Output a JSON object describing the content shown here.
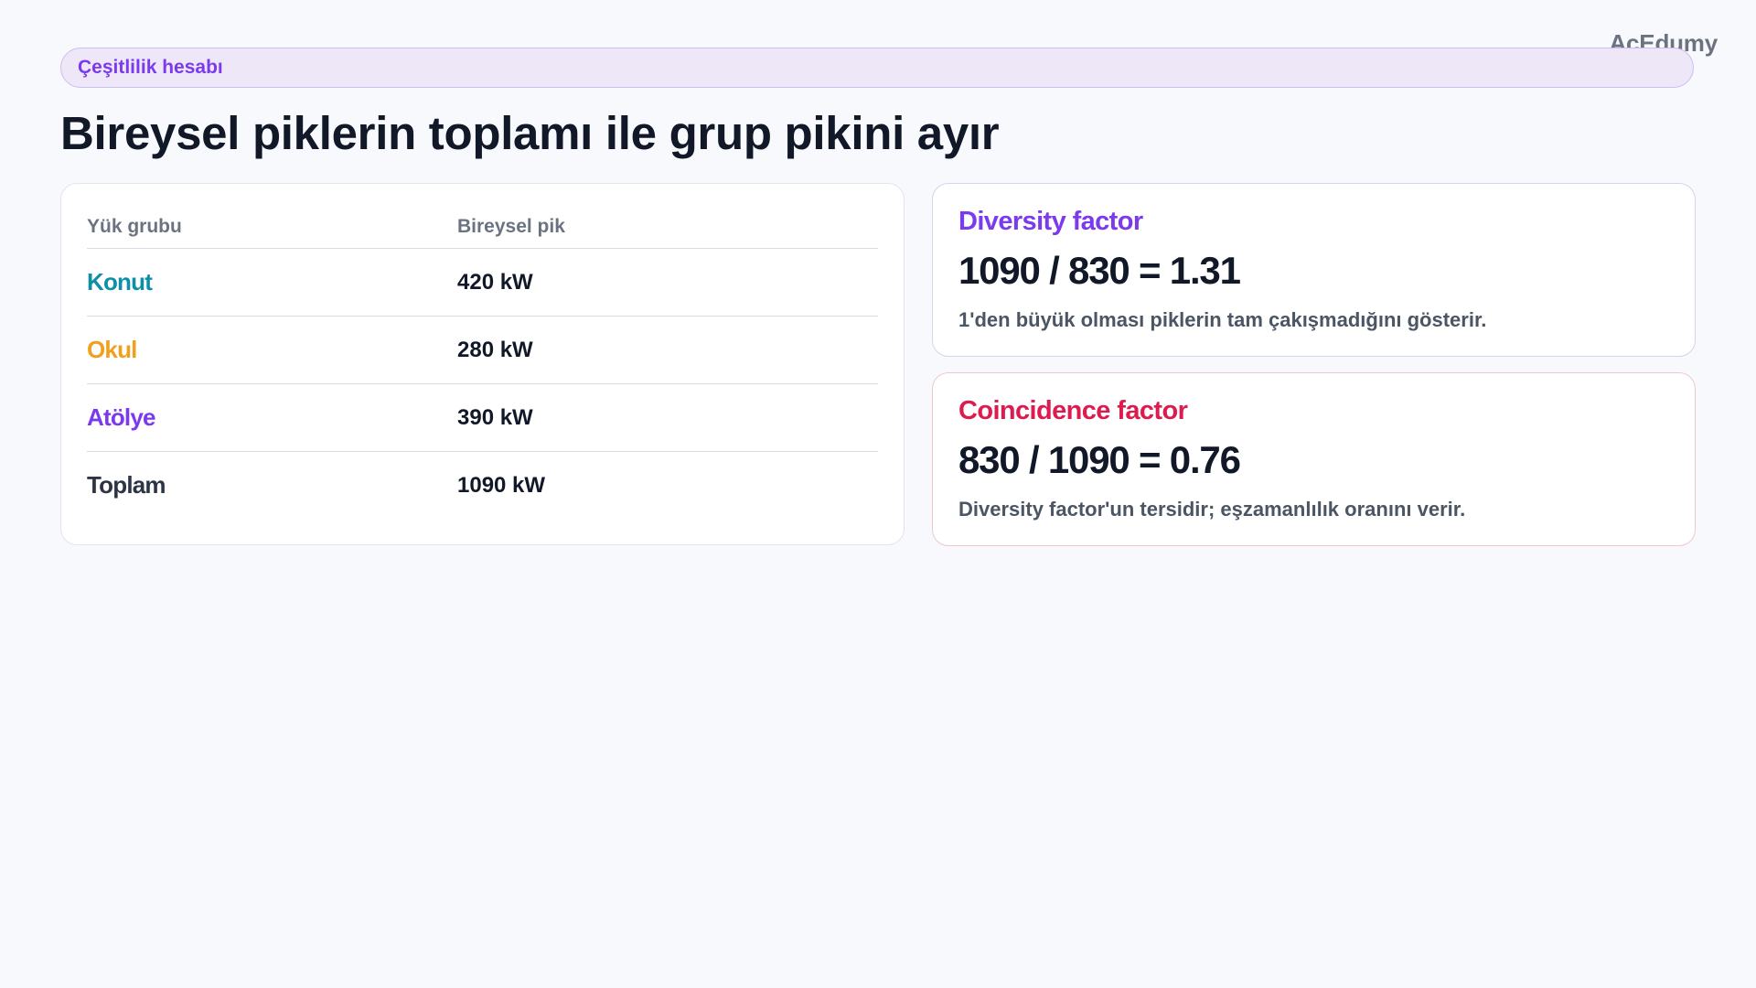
{
  "brand": "AcEdumy",
  "section_pill": "Çeşitlilik hesabı",
  "page_title": "Bireysel piklerin toplamı ile grup pikini ayır",
  "table": {
    "headers": [
      "Yük grubu",
      "Bireysel pik"
    ],
    "rows": [
      {
        "group": "Konut",
        "peak": "420 kW",
        "color": "#0e8fa8"
      },
      {
        "group": "Okul",
        "peak": "280 kW",
        "color": "#f0a01d"
      },
      {
        "group": "Atölye",
        "peak": "390 kW",
        "color": "#7c3aed"
      },
      {
        "group": "Toplam",
        "peak": "1090 kW",
        "color": "#2d3544"
      }
    ]
  },
  "factors": {
    "diversity": {
      "title": "Diversity factor",
      "formula": "1090 / 830 = 1.31",
      "note": "1'den büyük olması piklerin tam çakışmadığını gösterir.",
      "color": "#7c3aed"
    },
    "coincidence": {
      "title": "Coincidence factor",
      "formula": "830 / 1090 = 0.76",
      "note": "Diversity factor'un tersidir; eşzamanlılık oranını verir.",
      "color": "#dc1c4f"
    }
  }
}
